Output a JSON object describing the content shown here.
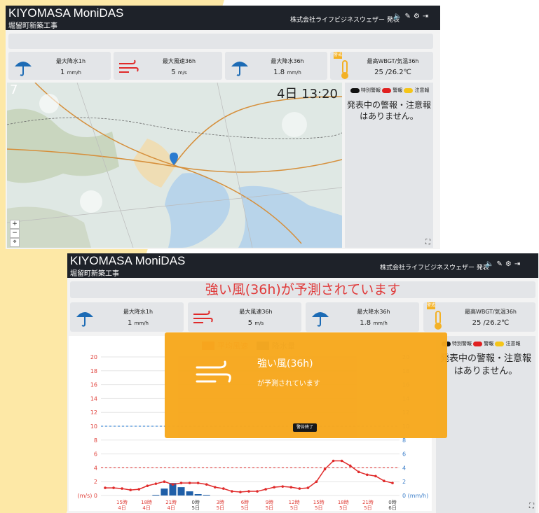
{
  "colors": {
    "background_shape": "#fde8a6",
    "topbar": "#1e2229",
    "alert_text": "#e03a3a",
    "modal": "#f7a81d",
    "rain_bar": "#1f5fa8",
    "wind_line": "#e02a2a",
    "warning_black": "#111111",
    "warning_red": "#e02020",
    "warning_yellow": "#f5c518"
  },
  "screen1": {
    "app_title": "KIYOMASA MoniDAS",
    "site_name": "堀留町新築工事",
    "publisher": "株式会社ライフビジネスウェザー 発表",
    "stats": [
      {
        "icon": "umbrella-rain-icon",
        "label": "最大降水1h",
        "value": "1",
        "unit": "mm/h"
      },
      {
        "icon": "wind-icon",
        "label": "最大風速36h",
        "value": "5",
        "unit": "m/s"
      },
      {
        "icon": "umbrella-rain-icon",
        "label": "最大降水36h",
        "value": "1.8",
        "unit": "mm/h"
      },
      {
        "icon": "thermometer-icon",
        "badge": "警戒",
        "label": "最高WBGT/気温36h",
        "value": "25 /26.2℃",
        "unit": ""
      }
    ],
    "map_number": "7",
    "datetime": "4日 13:20",
    "legend": [
      "特別警報",
      "警報",
      "注意報"
    ],
    "no_warning_line1": "発表中の警報・注意報",
    "no_warning_line2": "はありません。",
    "zoom_in": "+",
    "zoom_out": "−"
  },
  "screen2": {
    "app_title": "KIYOMASA MoniDAS",
    "site_name": "堀留町新築工事",
    "publisher": "株式会社ライフビジネスウェザー 発表",
    "alert_banner": "強い風(36h)が予測されています",
    "stats": [
      {
        "icon": "umbrella-rain-icon",
        "label": "最大降水1h",
        "value": "1",
        "unit": "mm/h"
      },
      {
        "icon": "wind-icon",
        "label": "最大風速36h",
        "value": "5",
        "unit": "m/s"
      },
      {
        "icon": "umbrella-rain-icon",
        "label": "最大降水36h",
        "value": "1.8",
        "unit": "mm/h"
      },
      {
        "icon": "thermometer-icon",
        "badge": "警戒",
        "label": "最高WBGT/気温36h",
        "value": "25 /26.2℃",
        "unit": ""
      }
    ],
    "legend": [
      "特別警報",
      "警報",
      "注意報"
    ],
    "no_warning_line1": "発表中の警報・注意報",
    "no_warning_line2": "はありません。",
    "modal": {
      "title": "強い風(36h)",
      "subtitle": "が予測されています",
      "button": "警告終了"
    }
  },
  "chart_data": {
    "type": "line",
    "title": "",
    "chart_number": "5",
    "series": [
      {
        "name": "平均風速",
        "axis": "left",
        "values": [
          1.1,
          1.1,
          1.0,
          0.8,
          0.9,
          1.4,
          1.7,
          2.0,
          1.6,
          1.8,
          1.8,
          1.8,
          1.6,
          1.2,
          1.0,
          0.6,
          0.5,
          0.6,
          0.6,
          0.9,
          1.2,
          1.3,
          1.2,
          1.0,
          1.1,
          2.0,
          3.8,
          5.0,
          5.0,
          4.3,
          3.4,
          3.0,
          2.8,
          2.1,
          1.8
        ]
      },
      {
        "name": "降水量",
        "axis": "right",
        "values": [
          0,
          0,
          0,
          0,
          0,
          0,
          0.1,
          1.0,
          1.8,
          1.2,
          0.6,
          0.2,
          0.1,
          0,
          0,
          0,
          0,
          0,
          0,
          0,
          0,
          0,
          0,
          0,
          0,
          0,
          0,
          0,
          0,
          0,
          0,
          0,
          0,
          0,
          0
        ]
      }
    ],
    "x_tick_labels": [
      {
        "time": "15時",
        "day": "4日"
      },
      {
        "time": "18時",
        "day": "4日"
      },
      {
        "time": "21時",
        "day": "4日"
      },
      {
        "time": "0時",
        "day": "5日"
      },
      {
        "time": "3時",
        "day": "5日"
      },
      {
        "time": "6時",
        "day": "5日"
      },
      {
        "time": "9時",
        "day": "5日"
      },
      {
        "time": "12時",
        "day": "5日"
      },
      {
        "time": "15時",
        "day": "5日"
      },
      {
        "time": "18時",
        "day": "5日"
      },
      {
        "time": "21時",
        "day": "5日"
      },
      {
        "time": "0時",
        "day": "6日"
      }
    ],
    "y_left": {
      "label": "(m/s)",
      "ticks": [
        0,
        2,
        4,
        6,
        8,
        10,
        12,
        14,
        16,
        18,
        20
      ],
      "range": [
        0,
        20
      ]
    },
    "y_right": {
      "label": "(mm/h)",
      "ticks": [
        0,
        2,
        4,
        6,
        8,
        10,
        12,
        14,
        16,
        18,
        20
      ],
      "range": [
        0,
        20
      ]
    },
    "threshold_lines": [
      {
        "value": 10,
        "color": "#1f77d0",
        "style": "dashed"
      },
      {
        "value": 4,
        "color": "#e02a2a",
        "style": "dashed"
      }
    ]
  }
}
